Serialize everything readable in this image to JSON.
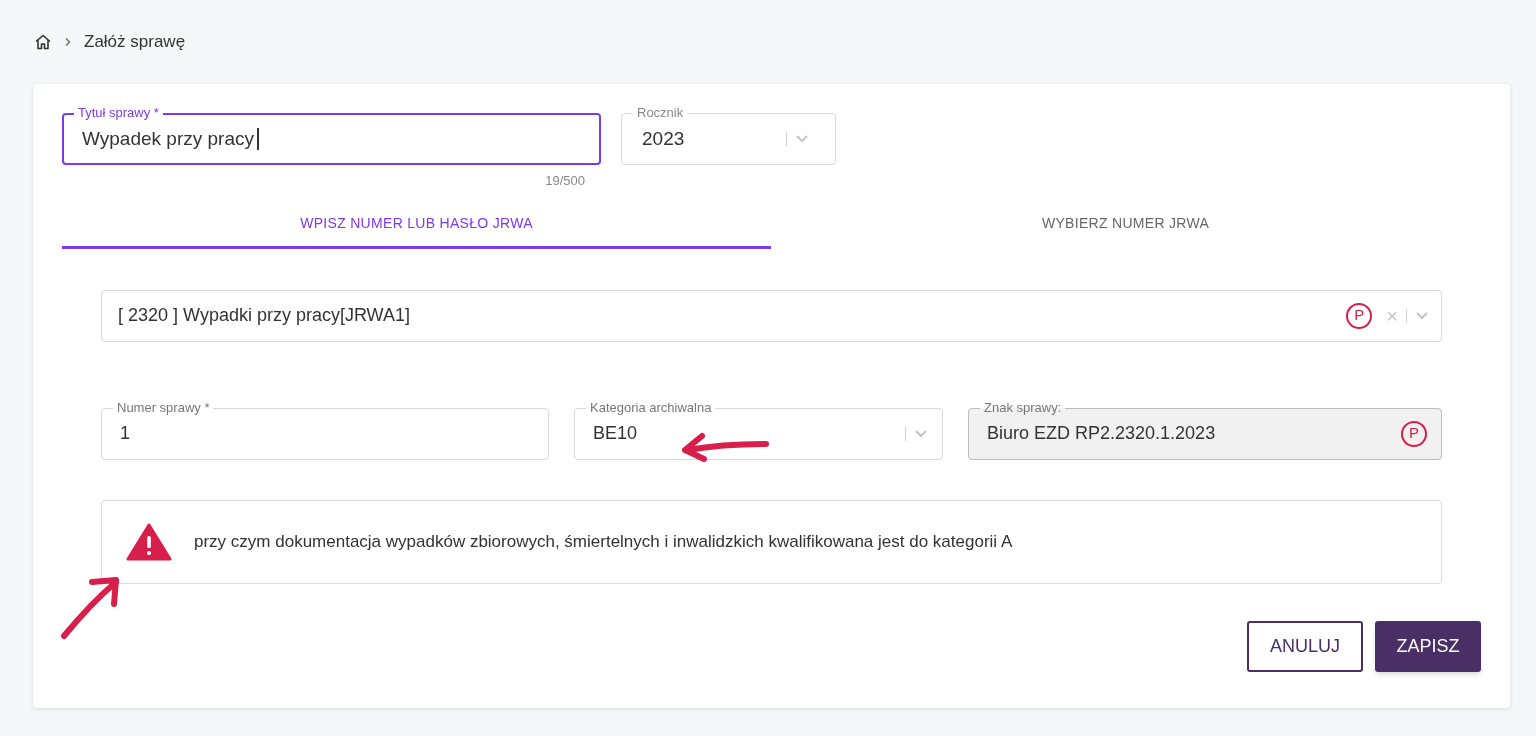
{
  "breadcrumb": {
    "items": [
      {
        "label": "Załóż sprawę"
      }
    ]
  },
  "title_field": {
    "label": "Tytuł sprawy *",
    "value": "Wypadek przy pracy",
    "focused": true,
    "counter": "19/500"
  },
  "year_field": {
    "label": "Rocznik",
    "value": "2023"
  },
  "tabs": [
    {
      "label": "WPISZ NUMER LUB HASŁO JRWA",
      "selected": true
    },
    {
      "label": "WYBIERZ NUMER JRWA",
      "selected": false
    }
  ],
  "jrwa_field": {
    "value": "[ 2320 ] Wypadki przy pracy[JRWA1]",
    "badge": "P",
    "clear": "×"
  },
  "fields": [
    {
      "kind": "input",
      "label": "Numer sprawy *",
      "value": "1"
    },
    {
      "kind": "select",
      "label": "Kategoria archiwalna",
      "value": "BE10"
    },
    {
      "kind": "readonly",
      "label": "Znak sprawy:",
      "value": "Biuro EZD RP2.2320.1.2023",
      "badge": "P"
    }
  ],
  "warning": {
    "text": "przy czym dokumentacja wypadków zbiorowych, śmiertelnych i inwalidzkich kwalifikowana jest do kategorii A"
  },
  "buttons": [
    {
      "kind": "outline",
      "label": "ANULUJ"
    },
    {
      "kind": "primary",
      "label": "ZAPISZ"
    }
  ]
}
